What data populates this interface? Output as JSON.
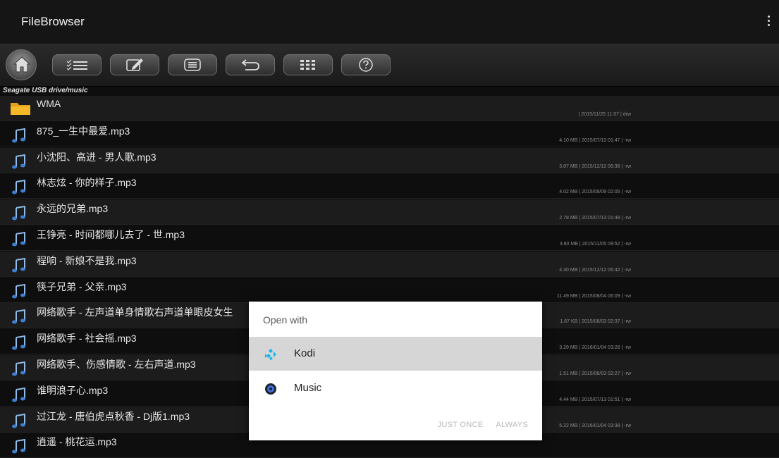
{
  "app": {
    "title": "FileBrowser"
  },
  "toolbar": {
    "buttons": [
      {
        "icon": "home-icon"
      },
      {
        "icon": "checklist-icon"
      },
      {
        "icon": "edit-icon"
      },
      {
        "icon": "list-icon"
      },
      {
        "icon": "undo-icon"
      },
      {
        "icon": "grid-icon"
      },
      {
        "icon": "help-icon"
      }
    ]
  },
  "path": "Seagate USB drive/music",
  "files": [
    {
      "name": "WMA",
      "meta": "| 2015/11/25 11:07 | drw",
      "type": "folder"
    },
    {
      "name": "875_一生中最爱.mp3",
      "meta": "4.10 MB | 2015/07/13 01:47 | -rw",
      "type": "audio"
    },
    {
      "name": "小沈阳、高进 - 男人歌.mp3",
      "meta": "3.87 MB | 2015/12/12 06:38 | -rw",
      "type": "audio"
    },
    {
      "name": "林志炫 - 你的样子.mp3",
      "meta": "4.02 MB | 2015/09/09 02:05 | -rw",
      "type": "audio"
    },
    {
      "name": "永远的兄弟.mp3",
      "meta": "2.78 MB | 2015/07/13 01:48 | -rw",
      "type": "audio"
    },
    {
      "name": "王铮亮 - 时间都哪儿去了 - 世.mp3",
      "meta": "3.80 MB | 2015/11/05 09:52 | -rw",
      "type": "audio"
    },
    {
      "name": "程响 - 新娘不是我.mp3",
      "meta": "4.30 MB | 2015/12/12 06:42 | -rw",
      "type": "audio"
    },
    {
      "name": "筷子兄弟 - 父亲.mp3",
      "meta": "11.49 MB | 2015/08/04 06:09 | -rw",
      "type": "audio"
    },
    {
      "name": "网络歌手 - 左声道单身情歌右声道单眼皮女生",
      "meta": "1.67 KB | 2015/08/03 02:37 | -rw",
      "type": "audio"
    },
    {
      "name": "网络歌手 - 社会摇.mp3",
      "meta": "3.29 MB | 2016/01/04 03:28 | -rw",
      "type": "audio"
    },
    {
      "name": "网络歌手、伤感情歌 - 左右声道.mp3",
      "meta": "1.51 MB | 2015/08/03 02:27 | -rw",
      "type": "audio"
    },
    {
      "name": "谁明浪子心.mp3",
      "meta": "4.44 MB | 2015/07/13 01:51 | -rw",
      "type": "audio"
    },
    {
      "name": "过江龙 - 唐伯虎点秋香 - Dj版1.mp3",
      "meta": "5.22 MB | 2016/01/04 03:38 | -rw",
      "type": "audio"
    },
    {
      "name": "逍遥 - 桃花运.mp3",
      "meta": "",
      "type": "audio"
    }
  ],
  "dialog": {
    "title": "Open with",
    "options": [
      {
        "label": "Kodi",
        "icon": "kodi-icon",
        "selected": true
      },
      {
        "label": "Music",
        "icon": "music-icon",
        "selected": false
      }
    ],
    "just_once": "JUST ONCE",
    "always": "ALWAYS"
  },
  "colors": {
    "background": "#0e0e0e",
    "dialog": "#ffffff",
    "selected": "#d6d6d6",
    "kodi_blue": "#17b2e7"
  }
}
